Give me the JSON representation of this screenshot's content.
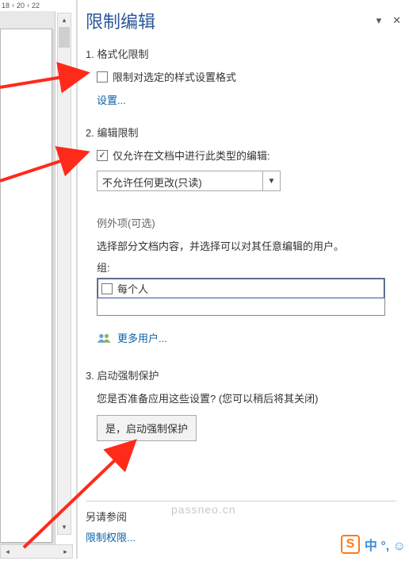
{
  "ruler": {
    "ticks": [
      "18",
      "20",
      "22"
    ]
  },
  "panel": {
    "title": "限制编辑",
    "section1": {
      "heading": "1. 格式化限制",
      "checkbox_label": "限制对选定的样式设置格式",
      "checkbox_checked": false,
      "settings_link": "设置..."
    },
    "section2": {
      "heading": "2. 编辑限制",
      "checkbox_label": "仅允许在文档中进行此类型的编辑:",
      "checkbox_checked": true,
      "dropdown_value": "不允许任何更改(只读)",
      "exceptions_label": "例外项(可选)",
      "exceptions_desc": "选择部分文档内容，并选择可以对其任意编辑的用户。",
      "group_label": "组:",
      "group_item": "每个人",
      "group_item_checked": false,
      "more_users": "更多用户..."
    },
    "section3": {
      "heading": "3. 启动强制保护",
      "question": "您是否准备应用这些设置? (您可以稍后将其关闭)",
      "button": "是，启动强制保护"
    },
    "see_also": "另请参阅",
    "restrict_perm": "限制权限..."
  },
  "watermark": "passneo.cn",
  "ime": {
    "logo": "S",
    "text": "中 °, ☺"
  }
}
